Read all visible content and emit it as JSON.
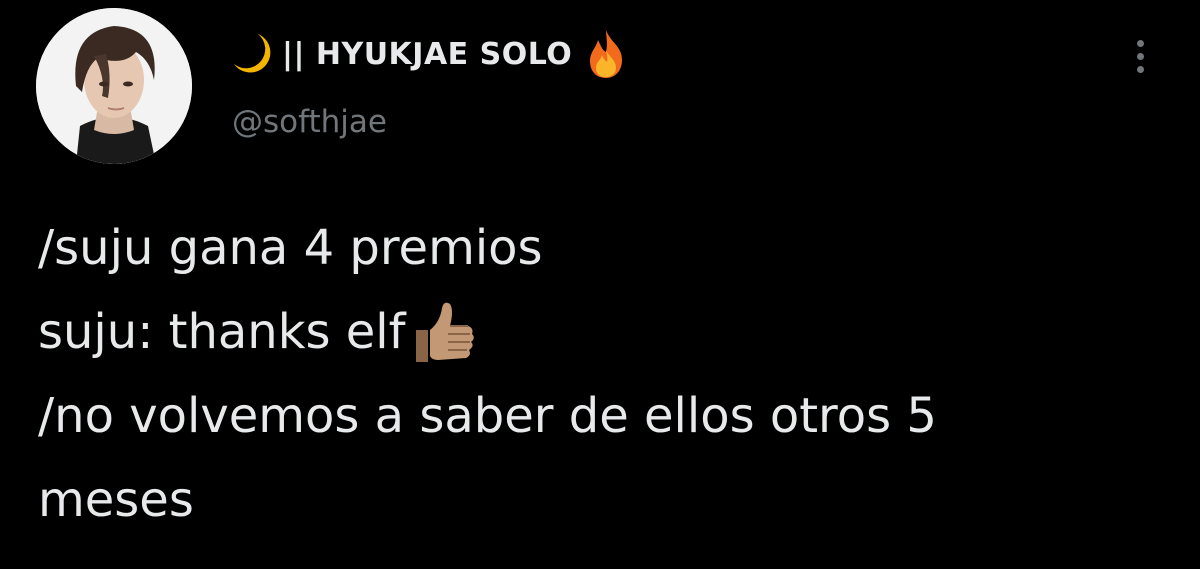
{
  "account": {
    "display_name": "|| HYUKJAE SOLO",
    "handle": "@softhjae",
    "name_icons": [
      "crescent-moon-emoji",
      "fire-emoji"
    ]
  },
  "menu": {
    "more_icon": "more-vertical-icon"
  },
  "tweet": {
    "lines": [
      "/suju gana 4 premios",
      "suju: thanks elf",
      "/no volvemos a saber de ellos otros 5",
      "meses"
    ],
    "inline_emoji": "thumbs-up-emoji"
  },
  "colors": {
    "background": "#000000",
    "text_primary": "#e7e9ea",
    "text_secondary": "#71767b"
  }
}
